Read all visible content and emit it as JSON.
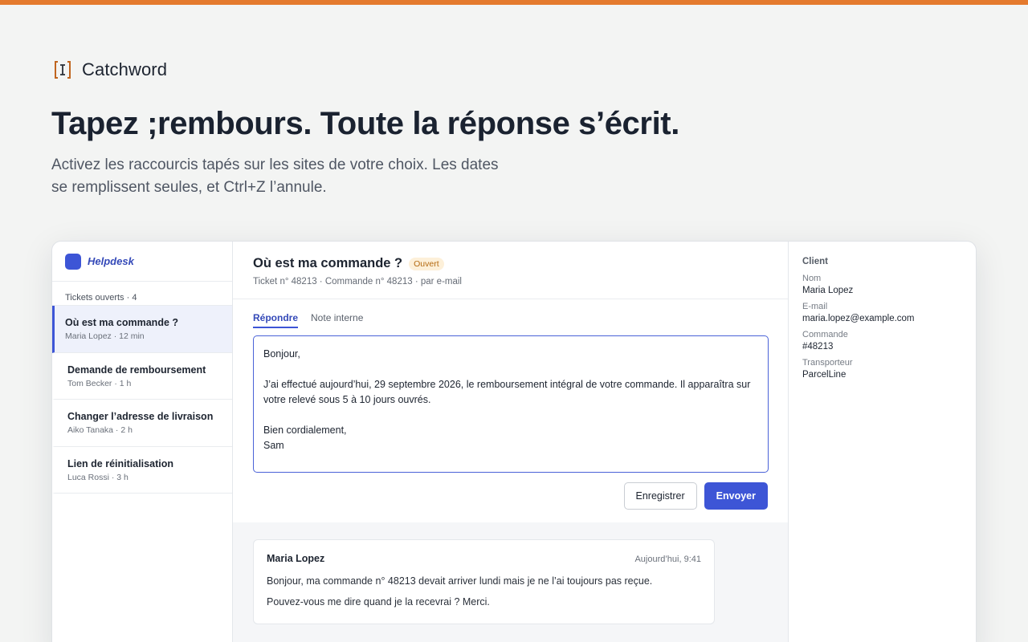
{
  "colors": {
    "accent": "#e47a2e",
    "primary": "#3d55d6",
    "badge_text": "#b46a12",
    "badge_bg": "#fdf0d9"
  },
  "brand": {
    "icon": "text-cursor-bracket-icon",
    "name": "Catchword"
  },
  "hero": {
    "headline": "Tapez ;rembours. Toute la réponse s’écrit.",
    "subline": "Activez les raccourcis tapés sur les sites de votre choix. Les dates se remplissent seules, et Ctrl+Z l’annule."
  },
  "sidebar": {
    "app_name": "Helpdesk",
    "header": "Tickets ouverts · 4",
    "tickets": [
      {
        "title": "Où est ma commande ?",
        "meta": "Maria Lopez · 12 min"
      },
      {
        "title": "Demande de remboursement",
        "meta": "Tom Becker · 1 h"
      },
      {
        "title": "Changer l’adresse de livraison",
        "meta": "Aiko Tanaka · 2 h"
      },
      {
        "title": "Lien de réinitialisation",
        "meta": "Luca Rossi · 3 h"
      }
    ]
  },
  "conversation": {
    "title": "Où est ma commande ?",
    "status": "Ouvert",
    "meta": "Ticket n° 48213 · Commande n° 48213 · par e-mail",
    "tabs": [
      "Répondre",
      "Note interne"
    ],
    "reply": {
      "greeting": "Bonjour,",
      "body": "J’ai effectué aujourd’hui, 29 septembre 2026, le remboursement intégral de votre commande. Il apparaîtra sur votre relevé sous 5 à 10 jours ouvrés.",
      "closing": "Bien cordialement,",
      "signature": "Sam"
    },
    "save_label": "Enregistrer",
    "send_label": "Envoyer",
    "message": {
      "author": "Maria Lopez",
      "time": "Aujourd’hui, 9:41",
      "line1": "Bonjour, ma commande n° 48213 devait arriver lundi mais je ne l’ai toujours pas reçue.",
      "line2": "Pouvez-vous me dire quand je la recevrai ? Merci."
    }
  },
  "client": {
    "header": "Client",
    "fields": [
      {
        "label": "Nom",
        "value": "Maria Lopez"
      },
      {
        "label": "E-mail",
        "value": "maria.lopez@example.com"
      },
      {
        "label": "Commande",
        "value": "#48213"
      },
      {
        "label": "Transporteur",
        "value": "ParcelLine"
      }
    ]
  }
}
